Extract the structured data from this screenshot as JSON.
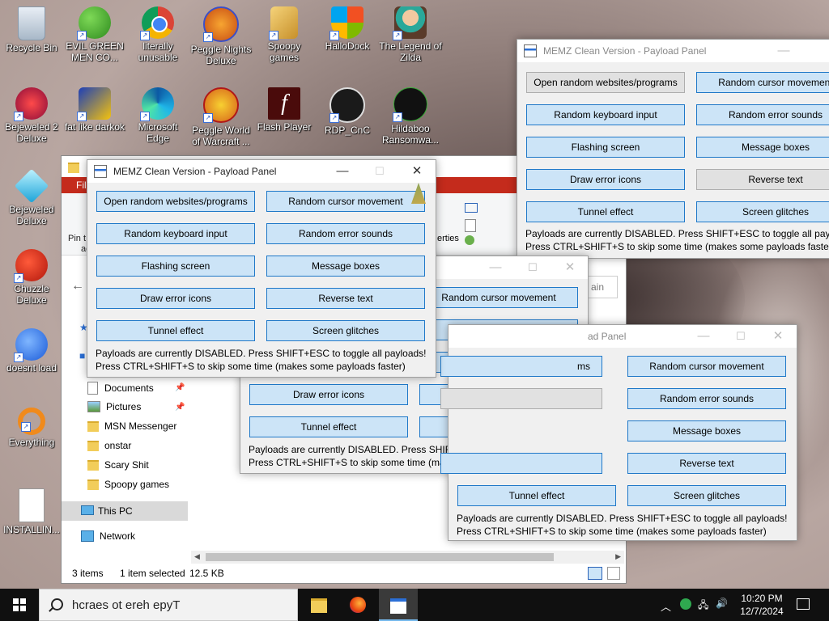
{
  "desktop": {
    "icons": [
      {
        "label": "Recycle Bin"
      },
      {
        "label": "EVIL GREEN MEN CO..."
      },
      {
        "label": "literally unusable"
      },
      {
        "label": "Peggle Nights Deluxe"
      },
      {
        "label": "Spoopy games"
      },
      {
        "label": "HalloDock"
      },
      {
        "label": "The Legend of Zilda"
      },
      {
        "label": "Bejeweled 2 Deluxe"
      },
      {
        "label": "fat like darkok"
      },
      {
        "label": "Microsoft Edge"
      },
      {
        "label": "Peggle World of Warcraft ..."
      },
      {
        "label": "Flash Player"
      },
      {
        "label": "RDP_CnC"
      },
      {
        "label": "Hildaboo Ransomwa..."
      },
      {
        "label": "Bejeweled Deluxe"
      },
      {
        "label": "Chuzzle Deluxe"
      },
      {
        "label": "doesnt load"
      },
      {
        "label": "Everything"
      },
      {
        "label": "INSTALLIN..."
      }
    ]
  },
  "memz": {
    "title": "MEMZ Clean Version - Payload Panel",
    "title_partial": "ad Panel",
    "buttons": [
      "Open random websites/programs",
      "Random cursor movement",
      "Random keyboard input",
      "Random error sounds",
      "Flashing screen",
      "Message boxes",
      "Draw error icons",
      "Reverse text",
      "Tunnel effect",
      "Screen glitches"
    ],
    "partial_button": "ms",
    "status_line1": "Payloads are currently DISABLED. Press SHIFT+ESC to toggle all payloads!",
    "status_line2": "Press CTRL+SHIFT+S to skip some time (makes some payloads faster)",
    "controls": {
      "minimize": "—",
      "maximize": "☐",
      "close": "✕"
    }
  },
  "explorer": {
    "ribbon_tab": "Fil",
    "pin_label": "Pin t",
    "pin_label2": "ac",
    "properties_fragment": "erties",
    "main_fragment": "ain",
    "nav": [
      {
        "label": "Documents",
        "pinned": true
      },
      {
        "label": "Pictures",
        "pinned": true
      },
      {
        "label": "MSN Messenger",
        "pinned": false
      },
      {
        "label": "onstar",
        "pinned": false
      },
      {
        "label": "Scary Shit",
        "pinned": false
      },
      {
        "label": "Spoopy games",
        "pinned": false
      },
      {
        "label": "This PC",
        "pinned": false
      },
      {
        "label": "Network",
        "pinned": false
      }
    ],
    "status_items": "3 items",
    "status_selected": "1 item selected",
    "status_size": "12.5 KB"
  },
  "taskbar": {
    "search_text": "hcraes ot ereh epyT",
    "time": "10:20 PM",
    "date": "12/7/2024"
  }
}
